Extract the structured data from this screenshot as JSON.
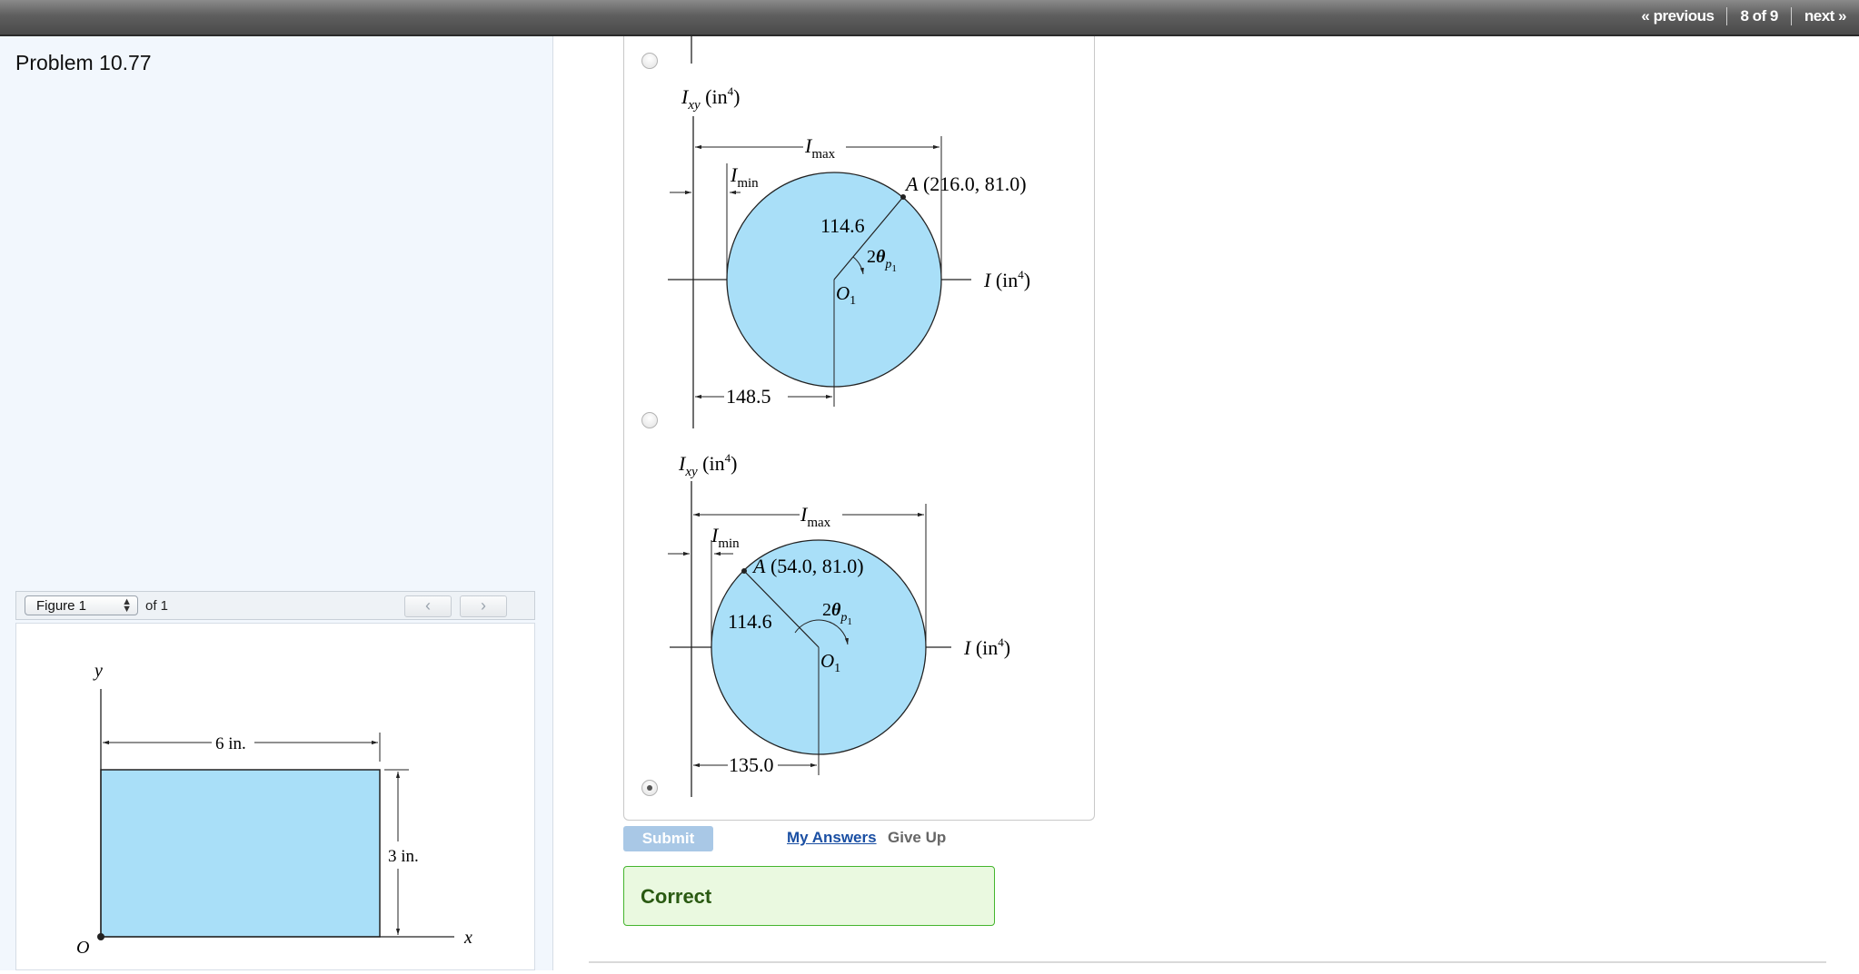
{
  "nav": {
    "previous": "« previous",
    "position": "8 of 9",
    "next": "next »"
  },
  "problem": {
    "title": "Problem 10.77"
  },
  "figure": {
    "selector_value": "Figure 1",
    "of_label": "of 1",
    "y_label": "y",
    "x_label": "x",
    "origin_label": "O",
    "width_label": "6 in.",
    "height_label": "3 in."
  },
  "options": [
    {
      "selected": false,
      "y_axis_label": "(in",
      "x_axis_label": "(in",
      "point_label": "(216.0, 81.0)",
      "radius_label": "114.6",
      "center_offset": "148.5"
    },
    {
      "selected": true,
      "y_axis_label": "(in",
      "x_axis_label": "(in",
      "point_label": "(54.0, 81.0)",
      "radius_label": "114.6",
      "center_offset": "135.0"
    }
  ],
  "actions": {
    "submit": "Submit",
    "my_answers": "My Answers",
    "give_up": "Give Up"
  },
  "feedback": {
    "status": "Correct"
  },
  "colors": {
    "circle_fill": "#a9dff8",
    "rect_fill": "#a9dff8",
    "correct_border": "#45b52e",
    "correct_bg": "#eaf9e0"
  }
}
